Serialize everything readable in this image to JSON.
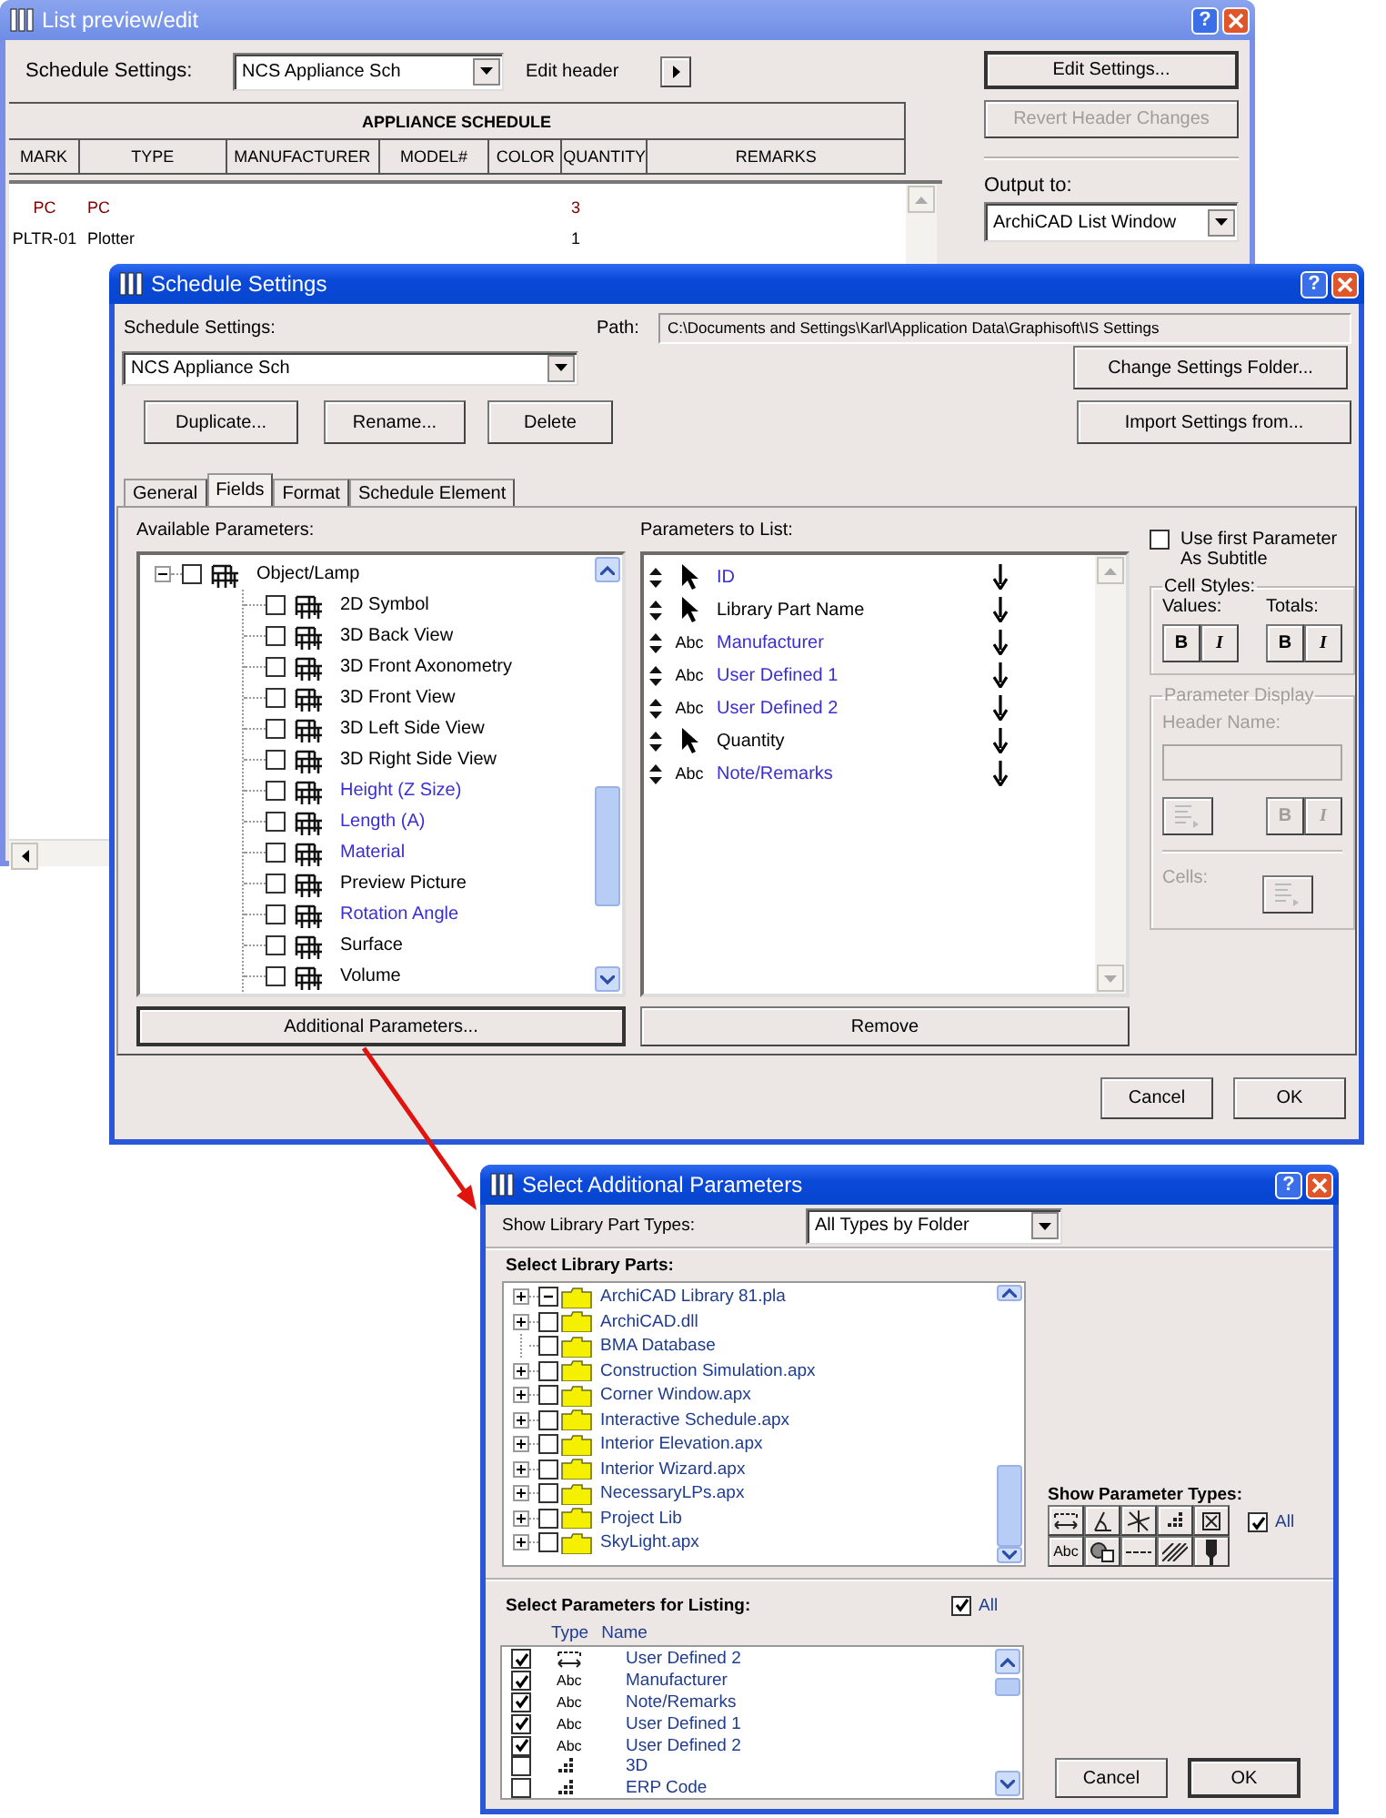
{
  "list_window": {
    "title": "List preview/edit",
    "help": "?",
    "settings_label": "Schedule Settings:",
    "settings_value": "NCS Appliance Sch",
    "edit_header_label": "Edit header",
    "buttons": [
      {
        "label": "Edit Settings...",
        "disabled": false
      },
      {
        "label": "Revert Header Changes",
        "disabled": true
      }
    ],
    "schedule": {
      "title": "APPLIANCE SCHEDULE",
      "columns": [
        "MARK",
        "TYPE",
        "MANUFACTURER",
        "MODEL#",
        "COLOR",
        "QUANTITY",
        "REMARKS"
      ],
      "rows": [
        {
          "color": "#800000",
          "mark": "PC",
          "type": "PC",
          "quantity": "3"
        },
        {
          "color": "#000000",
          "mark": "PLTR-01",
          "type": "Plotter",
          "quantity": "1"
        }
      ]
    },
    "output_label": "Output to:",
    "output_value": "ArchiCAD List Window"
  },
  "settings_dialog": {
    "title": "Schedule Settings",
    "help": "?",
    "settings_label": "Schedule Settings:",
    "settings_value": "NCS Appliance Sch",
    "path_label": "Path:",
    "path": "C:\\Documents and Settings\\Karl\\Application Data\\Graphisoft\\IS Settings",
    "left_buttons": [
      "Duplicate...",
      "Rename...",
      "Delete"
    ],
    "right_buttons": [
      "Change Settings Folder...",
      "Import Settings from..."
    ],
    "tabs": [
      {
        "label": "General",
        "selected": false
      },
      {
        "label": "Fields",
        "selected": true
      },
      {
        "label": "Format",
        "selected": false
      },
      {
        "label": "Schedule Element",
        "selected": false
      }
    ],
    "available": {
      "label": "Available Parameters:",
      "tree": [
        {
          "label": "Object/Lamp",
          "expanded": true,
          "checked": false,
          "children": [
            {
              "label": "2D Symbol",
              "checked": false,
              "color": "#000000"
            },
            {
              "label": "3D Back View",
              "checked": false,
              "color": "#000000"
            },
            {
              "label": "3D Front Axonometry",
              "checked": false,
              "color": "#000000"
            },
            {
              "label": "3D Front View",
              "checked": false,
              "color": "#000000"
            },
            {
              "label": "3D Left Side View",
              "checked": false,
              "color": "#000000"
            },
            {
              "label": "3D Right Side View",
              "checked": false,
              "color": "#000000"
            },
            {
              "label": "Height (Z Size)",
              "checked": false,
              "color": "#3a2fd0"
            },
            {
              "label": "Length (A)",
              "checked": false,
              "color": "#3a2fd0"
            },
            {
              "label": "Material",
              "checked": false,
              "color": "#3a2fd0"
            },
            {
              "label": "Preview Picture",
              "checked": false,
              "color": "#000000"
            },
            {
              "label": "Rotation Angle",
              "checked": false,
              "color": "#3a2fd0"
            },
            {
              "label": "Surface",
              "checked": false,
              "color": "#000000"
            },
            {
              "label": "Volume",
              "checked": false,
              "color": "#000000"
            }
          ]
        }
      ]
    },
    "to_list": {
      "label": "Parameters to List:",
      "items": [
        {
          "kind": "pointer",
          "label": "ID",
          "color": "#3a2fd0"
        },
        {
          "kind": "pointer",
          "label": "Library Part Name",
          "color": "#000000"
        },
        {
          "kind": "text",
          "type_label": "Abc",
          "label": "Manufacturer",
          "color": "#3a2fd0"
        },
        {
          "kind": "text",
          "type_label": "Abc",
          "label": "User Defined 1",
          "color": "#3a2fd0"
        },
        {
          "kind": "text",
          "type_label": "Abc",
          "label": "User Defined 2",
          "color": "#3a2fd0"
        },
        {
          "kind": "pointer",
          "label": "Quantity",
          "color": "#000000"
        },
        {
          "kind": "text",
          "type_label": "Abc",
          "label": "Note/Remarks",
          "color": "#3a2fd0"
        }
      ]
    },
    "subtitle_option": {
      "label": "Use first Parameter As Subtitle",
      "checked": false
    },
    "cell_styles": {
      "title": "Cell Styles:",
      "groups": [
        {
          "label": "Values:",
          "bold": "B",
          "italic": "I"
        },
        {
          "label": "Totals:",
          "bold": "B",
          "italic": "I"
        }
      ]
    },
    "parameter_display": {
      "title": "Parameter Display",
      "disabled": true,
      "header_label": "Header Name:",
      "bold": "B",
      "italic": "I",
      "cells_label": "Cells:"
    },
    "additional_button": "Additional Parameters...",
    "remove_button": "Remove",
    "cancel": "Cancel",
    "ok": "OK"
  },
  "additional_dialog": {
    "title": "Select Additional Parameters",
    "help": "?",
    "types_label": "Show Library Part Types:",
    "types_value": "All Types by Folder",
    "parts_label": "Select Library Parts:",
    "parts": [
      {
        "label": "ArchiCAD Library 81.pla",
        "expandable": true,
        "partial": true
      },
      {
        "label": "ArchiCAD.dll",
        "expandable": true,
        "checked": false
      },
      {
        "label": "BMA Database",
        "expandable": false,
        "checked": false
      },
      {
        "label": "Construction Simulation.apx",
        "expandable": true,
        "checked": false
      },
      {
        "label": "Corner Window.apx",
        "expandable": true,
        "checked": false
      },
      {
        "label": "Interactive Schedule.apx",
        "expandable": true,
        "checked": false
      },
      {
        "label": "Interior Elevation.apx",
        "expandable": true,
        "checked": false
      },
      {
        "label": "Interior Wizard.apx",
        "expandable": true,
        "checked": false
      },
      {
        "label": "NecessaryLPs.apx",
        "expandable": true,
        "checked": false
      },
      {
        "label": "Project Lib",
        "expandable": true,
        "checked": false
      },
      {
        "label": "SkyLight.apx",
        "expandable": true,
        "checked": false
      }
    ],
    "param_types_label": "Show Parameter Types:",
    "param_types": [
      {
        "kind": "length"
      },
      {
        "kind": "angle"
      },
      {
        "kind": "real"
      },
      {
        "kind": "integer"
      },
      {
        "kind": "boolean"
      },
      {
        "kind": "text",
        "type_label": "Abc"
      },
      {
        "kind": "material"
      },
      {
        "kind": "line"
      },
      {
        "kind": "fill"
      },
      {
        "kind": "pen"
      }
    ],
    "all_types": {
      "label": "All",
      "checked": true
    },
    "listing_label": "Select Parameters for Listing:",
    "listing_all": {
      "label": "All",
      "checked": true
    },
    "listing_columns": [
      "Type",
      "Name"
    ],
    "listing": [
      {
        "checked": true,
        "kind": "length",
        "label": "User Defined 2"
      },
      {
        "checked": true,
        "kind": "text",
        "type_label": "Abc",
        "label": "Manufacturer"
      },
      {
        "checked": true,
        "kind": "text",
        "type_label": "Abc",
        "label": "Note/Remarks"
      },
      {
        "checked": true,
        "kind": "text",
        "type_label": "Abc",
        "label": "User Defined 1"
      },
      {
        "checked": true,
        "kind": "text",
        "type_label": "Abc",
        "label": "User Defined 2"
      },
      {
        "checked": false,
        "kind": "integer",
        "label": "3D"
      },
      {
        "checked": false,
        "kind": "integer",
        "label": "ERP Code"
      }
    ],
    "cancel": "Cancel",
    "ok": "OK"
  }
}
